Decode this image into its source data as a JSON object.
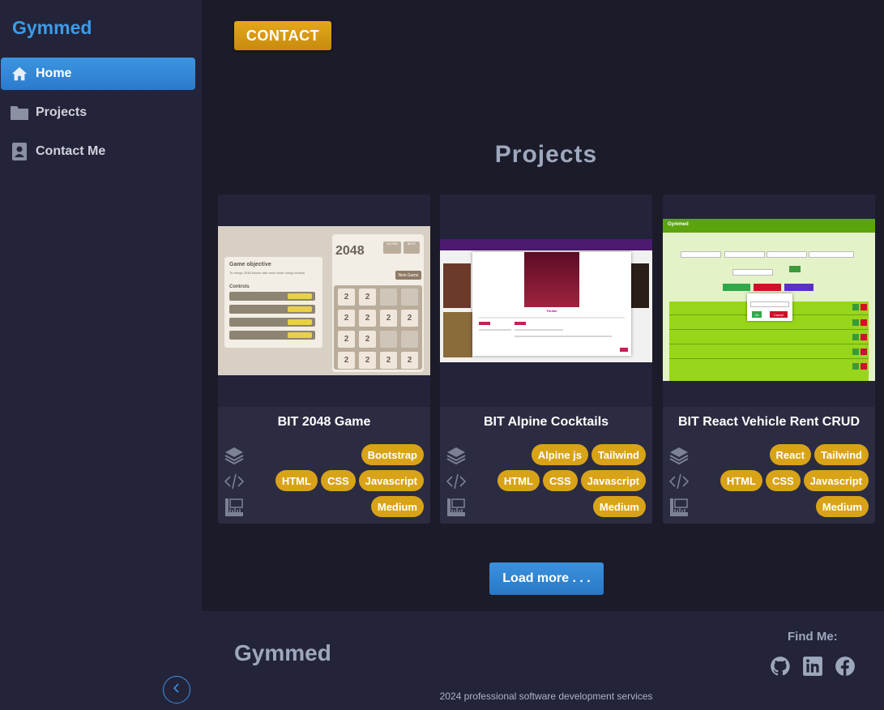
{
  "sidebar": {
    "brand": "Gymmed",
    "items": [
      {
        "label": "Home",
        "icon": "home-icon",
        "active": true
      },
      {
        "label": "Projects",
        "icon": "folder-icon",
        "active": false
      },
      {
        "label": "Contact Me",
        "icon": "contact-card-icon",
        "active": false
      }
    ],
    "collapse_icon": "chevron-left-icon"
  },
  "header": {
    "contact_label": "CONTACT"
  },
  "projects": {
    "title": "Projects",
    "cards": [
      {
        "title": "BIT 2048 Game",
        "stack": [
          "Bootstrap"
        ],
        "tech": [
          "HTML",
          "CSS",
          "Javascript"
        ],
        "difficulty": [
          "Medium"
        ]
      },
      {
        "title": "BIT Alpine Cocktails",
        "stack": [
          "Alpine js",
          "Tailwind"
        ],
        "tech": [
          "HTML",
          "CSS",
          "Javascript"
        ],
        "difficulty": [
          "Medium"
        ]
      },
      {
        "title": "BIT React Vehicle Rent CRUD",
        "stack": [
          "React",
          "Tailwind"
        ],
        "tech": [
          "HTML",
          "CSS",
          "Javascript"
        ],
        "difficulty": [
          "Medium"
        ]
      }
    ],
    "load_more_label": "Load more . . ."
  },
  "shot_2048": {
    "objective_title": "Game objective",
    "objective_text": "To merge 2048 blocks with each other using controls",
    "controls_title": "Controls",
    "game_title": "2048",
    "score_label": "SCORE",
    "best_label": "BEST",
    "new_game_label": "New Game",
    "tile_value": "2"
  },
  "shot_cocktail": {
    "caption": "Thriller"
  },
  "shot_crud": {
    "brand": "Gymmed",
    "ok_label": "Ok",
    "cancel_label": "Cancel"
  },
  "footer": {
    "brand": "Gymmed",
    "find_me": "Find Me:",
    "socials": [
      "github-icon",
      "linkedin-icon",
      "facebook-icon"
    ],
    "copyright": "2024 professional software development services"
  },
  "colors": {
    "accent": "#3d9be9",
    "tag": "#d9a318",
    "contact": "#d89a12"
  }
}
